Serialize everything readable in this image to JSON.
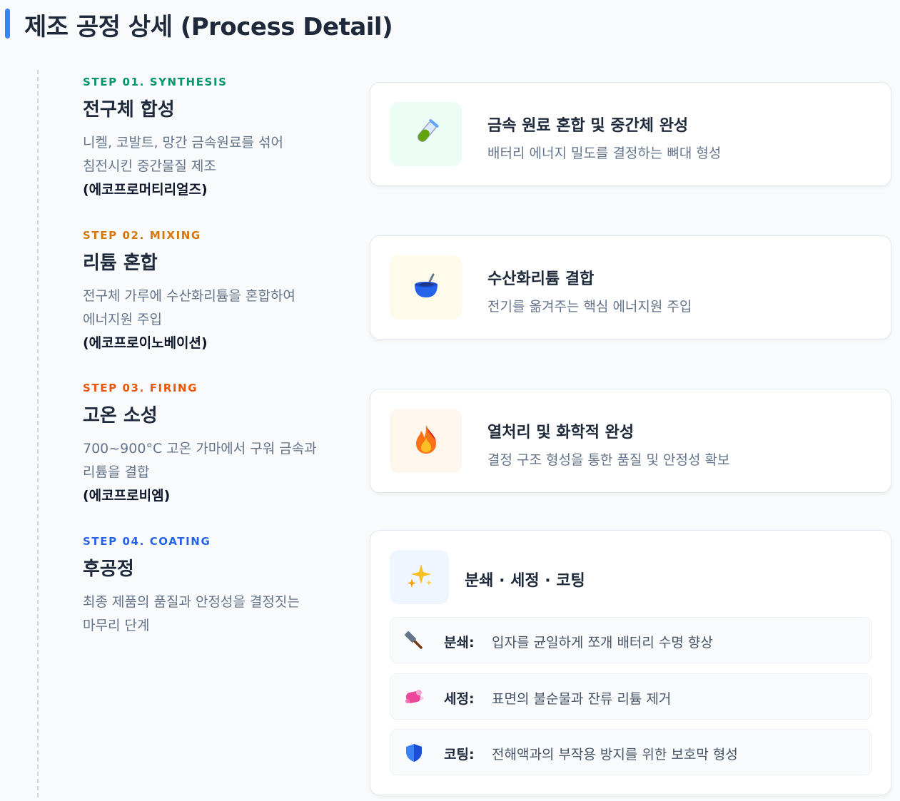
{
  "page": {
    "title": "제조 공정 상세 (Process Detail)"
  },
  "steps": [
    {
      "label": "STEP 01. SYNTHESIS",
      "label_color": "#059669",
      "heading": "전구체 합성",
      "desc_line1": "니켈, 코발트, 망간 금속원료를 섞어",
      "desc_line2": "침전시킨 중간물질 제조",
      "company": "(에코프로머티리얼즈)",
      "card": {
        "icon": "test-tube-icon",
        "icon_bg": "#ecfdf5",
        "title": "금속 원료 혼합 및 중간체 완성",
        "subtitle": "배터리 에너지 밀도를 결정하는 뼈대 형성"
      }
    },
    {
      "label": "STEP 02. MIXING",
      "label_color": "#d97706",
      "heading": "리튬 혼합",
      "desc_line1": "전구체 가루에 수산화리튬을 혼합하여",
      "desc_line2": "에너지원 주입",
      "company": "(에코프로이노베이션)",
      "card": {
        "icon": "mortar-pestle-icon",
        "icon_bg": "#fffbeb",
        "title": "수산화리튬 결합",
        "subtitle": "전기를 옮겨주는 핵심 에너지원 주입"
      }
    },
    {
      "label": "STEP 03. FIRING",
      "label_color": "#ea580c",
      "heading": "고온 소성",
      "desc_line1": "700~900°C 고온 가마에서 구워 금속과",
      "desc_line2": "리튬을 결합",
      "company": "(에코프로비엠)",
      "card": {
        "icon": "fire-icon",
        "icon_bg": "#fff7ed",
        "title": "열처리 및 화학적 완성",
        "subtitle": "결정 구조 형성을 통한 품질 및 안정성 확보"
      }
    },
    {
      "label": "STEP 04. COATING",
      "label_color": "#2563eb",
      "heading": "후공정",
      "desc_line1": "최종 제품의 품질과 안정성을 결정짓는",
      "desc_line2": "마무리 단계",
      "card": {
        "icon": "sparkles-icon",
        "icon_bg": "#eff6ff",
        "title": "분쇄 · 세정 · 코팅",
        "items": [
          {
            "icon": "hammer-icon",
            "label": "분쇄:",
            "text": "입자를 균일하게 쪼개 배터리 수명 향상"
          },
          {
            "icon": "soap-bubble-icon",
            "label": "세정:",
            "text": "표면의 불순물과 잔류 리튬 제거"
          },
          {
            "icon": "shield-icon",
            "label": "코팅:",
            "text": "전해액과의 부작용 방지를 위한 보호막 형성"
          }
        ]
      }
    }
  ]
}
